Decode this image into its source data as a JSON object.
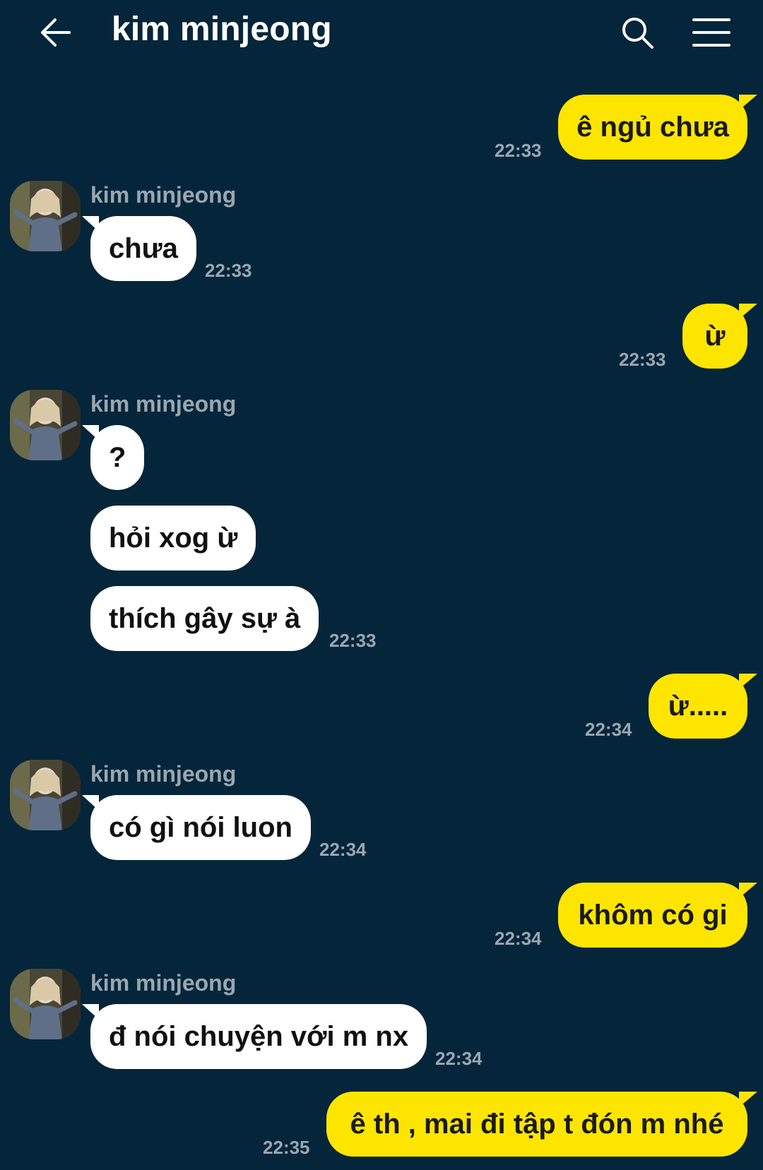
{
  "header": {
    "title": "kim minjeong",
    "back_icon": "arrow-left-icon",
    "search_icon": "search-icon",
    "menu_icon": "hamburger-menu-icon"
  },
  "colors": {
    "background": "#05253a",
    "outgoing_bubble": "#fee500",
    "incoming_bubble": "#ffffff",
    "timestamp": "#9aa7b1"
  },
  "contact": {
    "name": "kim minjeong"
  },
  "messages": [
    {
      "direction": "out",
      "text": "ê ngủ chưa",
      "time": "22:33"
    },
    {
      "direction": "in",
      "text": "chưa",
      "time": "22:33"
    },
    {
      "direction": "out",
      "text": "ừ",
      "time": "22:33"
    },
    {
      "direction": "in",
      "text": "?",
      "time": ""
    },
    {
      "direction": "in",
      "text": "hỏi xog ừ",
      "time": ""
    },
    {
      "direction": "in",
      "text": "thích gây sự à",
      "time": "22:33"
    },
    {
      "direction": "out",
      "text": "ừ.....",
      "time": "22:34"
    },
    {
      "direction": "in",
      "text": "có gì nói luon",
      "time": "22:34"
    },
    {
      "direction": "out",
      "text": "khôm có gi",
      "time": "22:34"
    },
    {
      "direction": "in",
      "text": "đ nói chuyện với m nx",
      "time": "22:34"
    },
    {
      "direction": "out",
      "text": "ê th , mai đi tập t đón m nhé",
      "time": "22:35"
    }
  ]
}
